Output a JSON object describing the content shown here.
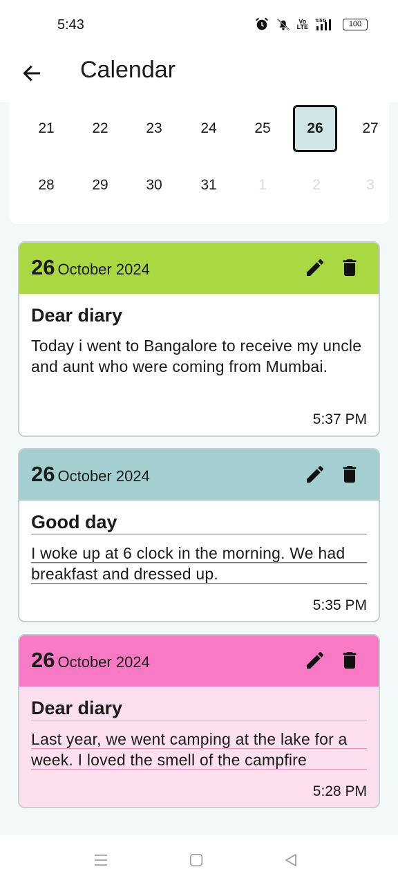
{
  "status_bar": {
    "time": "5:43",
    "icons": [
      "alarm-icon",
      "mute-icon",
      "volte-icon",
      "5g-signal-icon",
      "battery-icon"
    ],
    "volte_top": "Vo",
    "volte_bottom": "LTE",
    "battery": "100"
  },
  "app_bar": {
    "title": "Calendar"
  },
  "calendar": {
    "weeks": [
      [
        {
          "day": "21",
          "state": "current"
        },
        {
          "day": "22",
          "state": "current"
        },
        {
          "day": "23",
          "state": "current"
        },
        {
          "day": "24",
          "state": "current"
        },
        {
          "day": "25",
          "state": "current"
        },
        {
          "day": "26",
          "state": "selected"
        },
        {
          "day": "27",
          "state": "current"
        }
      ],
      [
        {
          "day": "28",
          "state": "current"
        },
        {
          "day": "29",
          "state": "current"
        },
        {
          "day": "30",
          "state": "current"
        },
        {
          "day": "31",
          "state": "current"
        },
        {
          "day": "1",
          "state": "other"
        },
        {
          "day": "2",
          "state": "other"
        },
        {
          "day": "3",
          "state": "other"
        }
      ]
    ]
  },
  "entries": [
    {
      "day": "26",
      "month_year": "October 2024",
      "title": "Dear diary",
      "text": "Today i went to Bangalore to receive my uncle and aunt who were coming from Mumbai.",
      "time": "5:37 PM",
      "header_color": "#a9d843",
      "body_color": "#ffffff"
    },
    {
      "day": "26",
      "month_year": "October 2024",
      "title": "Good day",
      "text": "I woke up at 6 clock in the morning. We had breakfast and dressed up.",
      "time": "5:35 PM",
      "header_color": "#a3cfd0",
      "body_color": "#ffffff"
    },
    {
      "day": "26",
      "month_year": "October 2024",
      "title": "Dear diary",
      "text": "Last year, we went camping at the lake for a week. I loved the smell of the campfire",
      "time": "5:28 PM",
      "header_color": "#f97ac4",
      "body_color": "#fde0ef"
    }
  ],
  "nav_bar": {
    "icons": [
      "menu-icon",
      "home-icon",
      "back-triangle-icon"
    ]
  }
}
